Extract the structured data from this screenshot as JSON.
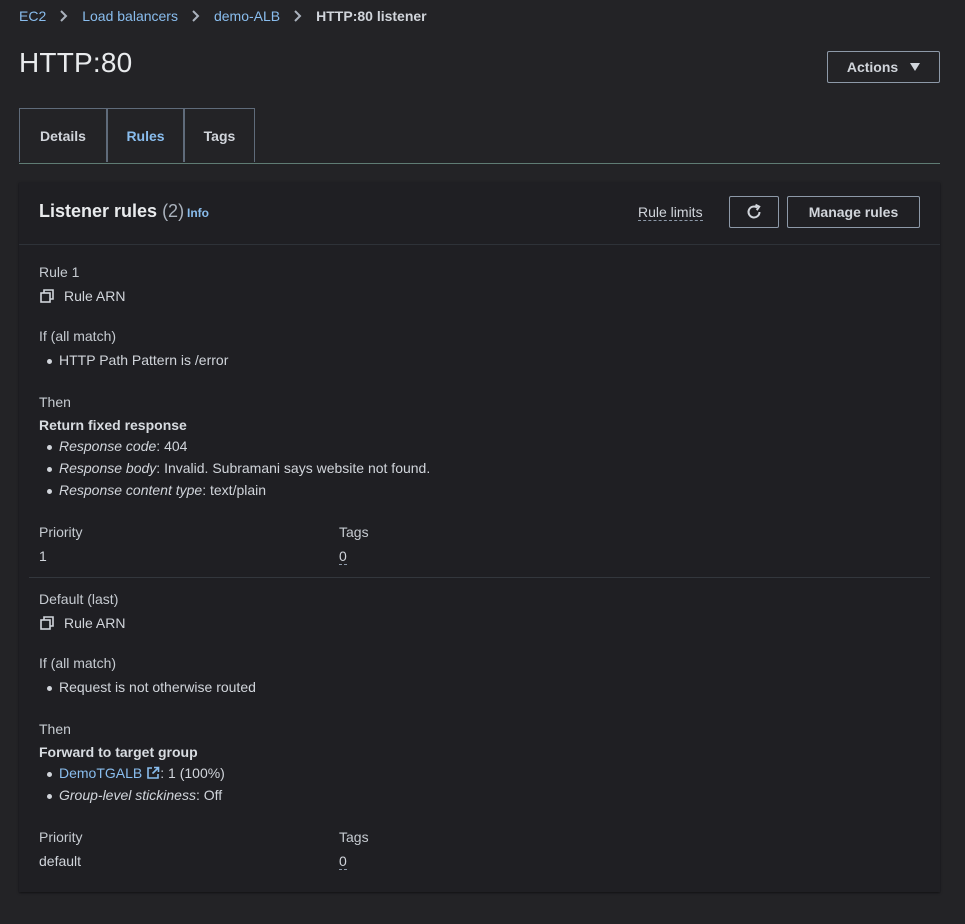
{
  "breadcrumb": {
    "items": [
      "EC2",
      "Load balancers",
      "demo-ALB"
    ],
    "current": "HTTP:80 listener"
  },
  "page": {
    "title": "HTTP:80",
    "actions_label": "Actions"
  },
  "tabs": [
    {
      "label": "Details",
      "active": false
    },
    {
      "label": "Rules",
      "active": true
    },
    {
      "label": "Tags",
      "active": false
    }
  ],
  "panel": {
    "title": "Listener rules",
    "count": "(2)",
    "info": "Info",
    "rule_limits": "Rule limits",
    "manage_rules": "Manage rules",
    "refresh_icon": "refresh-icon"
  },
  "rules": [
    {
      "name": "Rule 1",
      "arn_label": "Rule ARN",
      "condition_heading": "If (all match)",
      "conditions": [
        "HTTP Path Pattern is /error"
      ],
      "then_heading": "Then",
      "action_title": "Return fixed response",
      "action_items": [
        {
          "key": "Response code",
          "value": ": 404"
        },
        {
          "key": "Response body",
          "value": ": Invalid. Subramani says website not found."
        },
        {
          "key": "Response content type",
          "value": ": text/plain"
        }
      ],
      "priority_label": "Priority",
      "priority": "1",
      "tags_label": "Tags",
      "tags": "0"
    },
    {
      "name": "Default (last)",
      "arn_label": "Rule ARN",
      "condition_heading": "If (all match)",
      "conditions": [
        "Request is not otherwise routed"
      ],
      "then_heading": "Then",
      "action_title": "Forward to target group",
      "target_group_link": "DemoTGALB",
      "target_group_weight": ": 1 (100%)",
      "stickiness_key": "Group-level stickiness",
      "stickiness_value": ": Off",
      "priority_label": "Priority",
      "priority": "default",
      "tags_label": "Tags",
      "tags": "0"
    }
  ],
  "colors": {
    "background": "#232326",
    "panel": "#1f1f23",
    "link": "#89bdee",
    "text": "#d1d5db"
  }
}
